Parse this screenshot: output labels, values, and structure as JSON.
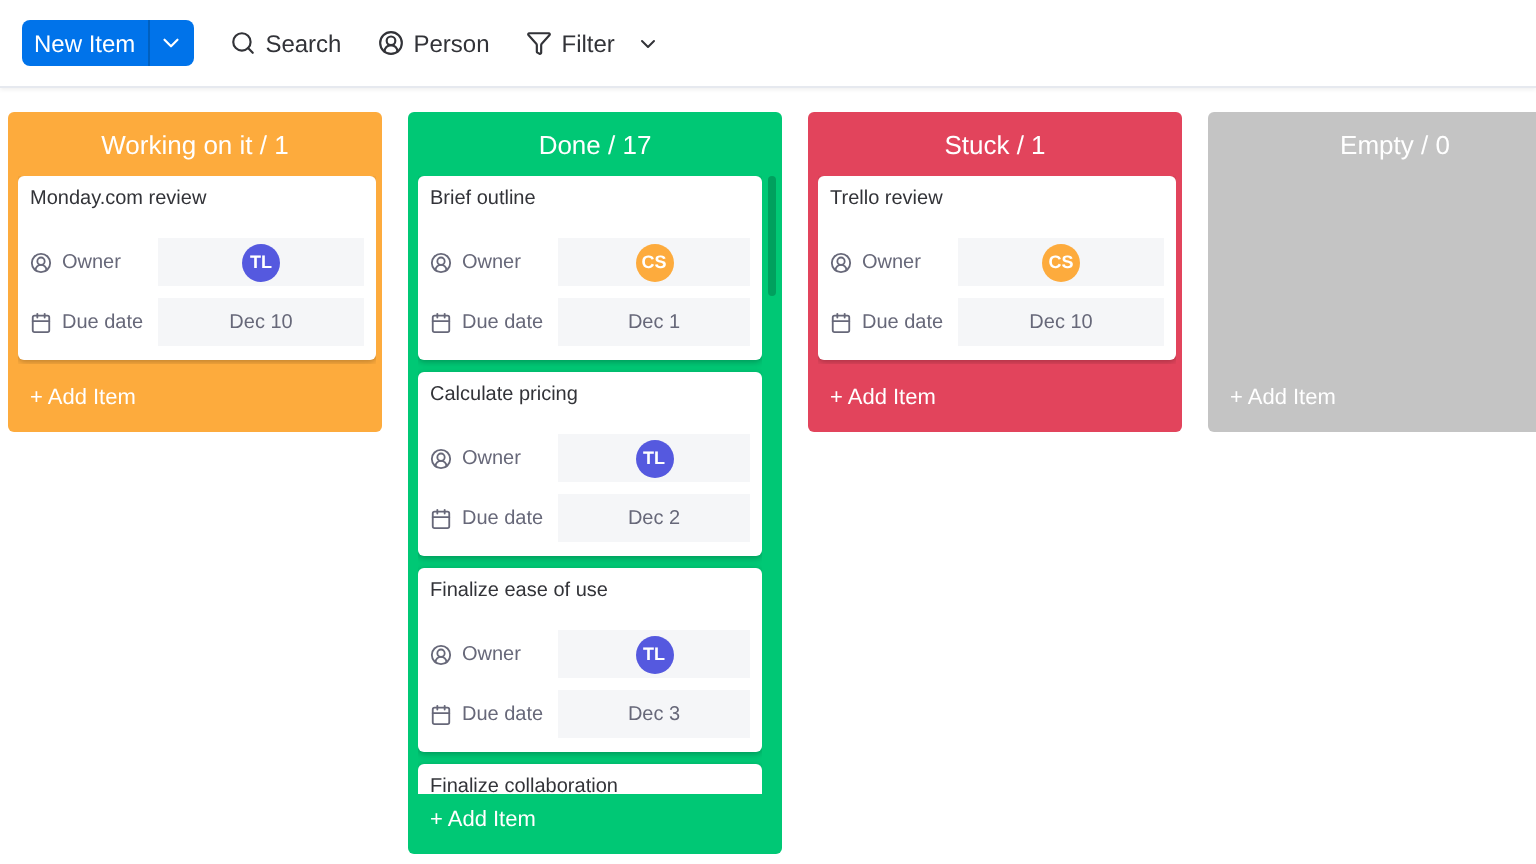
{
  "toolbar": {
    "new_item": "New Item",
    "search": "Search",
    "person": "Person",
    "filter": "Filter"
  },
  "columns": [
    {
      "title": "Working on it / 1",
      "color": "#fdab3d",
      "scrollable": false,
      "add_label": "+ Add Item",
      "cards": [
        {
          "title": "Monday.com review",
          "owner_label": "Owner",
          "owner": {
            "initials": "TL",
            "color": "#5559df"
          },
          "date_label": "Due date",
          "date": "Dec 10"
        }
      ]
    },
    {
      "title": "Done / 17",
      "color": "#00c875",
      "scrollable": true,
      "add_label": "+ Add Item",
      "cards": [
        {
          "title": "Brief outline",
          "owner_label": "Owner",
          "owner": {
            "initials": "CS",
            "color": "#fdab3d"
          },
          "date_label": "Due date",
          "date": "Dec 1"
        },
        {
          "title": "Calculate pricing",
          "owner_label": "Owner",
          "owner": {
            "initials": "TL",
            "color": "#5559df"
          },
          "date_label": "Due date",
          "date": "Dec 2"
        },
        {
          "title": "Finalize ease of use",
          "owner_label": "Owner",
          "owner": {
            "initials": "TL",
            "color": "#5559df"
          },
          "date_label": "Due date",
          "date": "Dec 3"
        },
        {
          "title": "Finalize collaboration"
        }
      ]
    },
    {
      "title": "Stuck / 1",
      "color": "#e2445c",
      "scrollable": false,
      "add_label": "+ Add Item",
      "cards": [
        {
          "title": "Trello review",
          "owner_label": "Owner",
          "owner": {
            "initials": "CS",
            "color": "#fdab3d"
          },
          "date_label": "Due date",
          "date": "Dec 10"
        }
      ]
    },
    {
      "title": "Empty / 0",
      "color": "#c4c4c4",
      "scrollable": false,
      "add_label": "+ Add Item"
    }
  ]
}
